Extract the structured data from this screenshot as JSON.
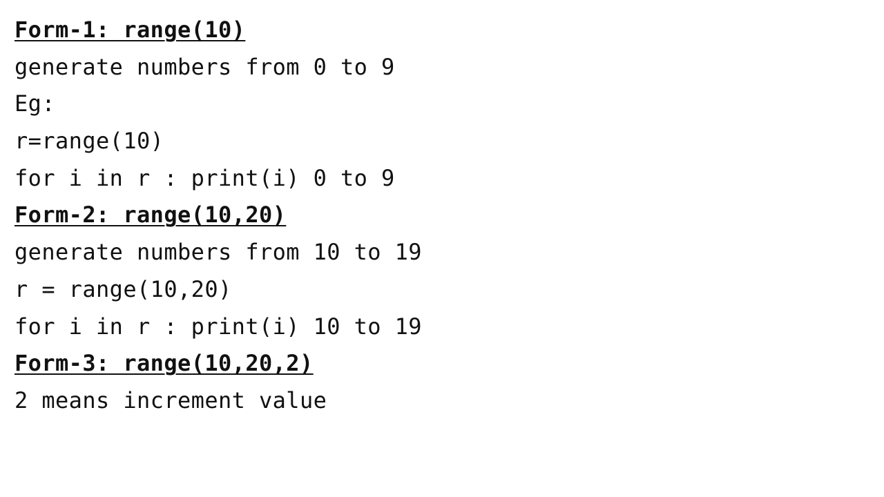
{
  "lines": [
    {
      "text": "Form-1: range(10)",
      "kind": "heading"
    },
    {
      "text": "generate numbers from 0 to 9",
      "kind": "text"
    },
    {
      "text": "Eg:",
      "kind": "text"
    },
    {
      "text": "r=range(10)",
      "kind": "text"
    },
    {
      "text": "for i in r : print(i) 0 to 9",
      "kind": "text"
    },
    {
      "text": "Form-2: range(10,20)",
      "kind": "heading"
    },
    {
      "text": "generate numbers from 10 to 19",
      "kind": "text"
    },
    {
      "text": "r = range(10,20)",
      "kind": "text"
    },
    {
      "text": "for i in r : print(i) 10 to 19",
      "kind": "text"
    },
    {
      "text": "Form-3: range(10,20,2)",
      "kind": "heading"
    },
    {
      "text": "2 means increment value",
      "kind": "text"
    }
  ]
}
